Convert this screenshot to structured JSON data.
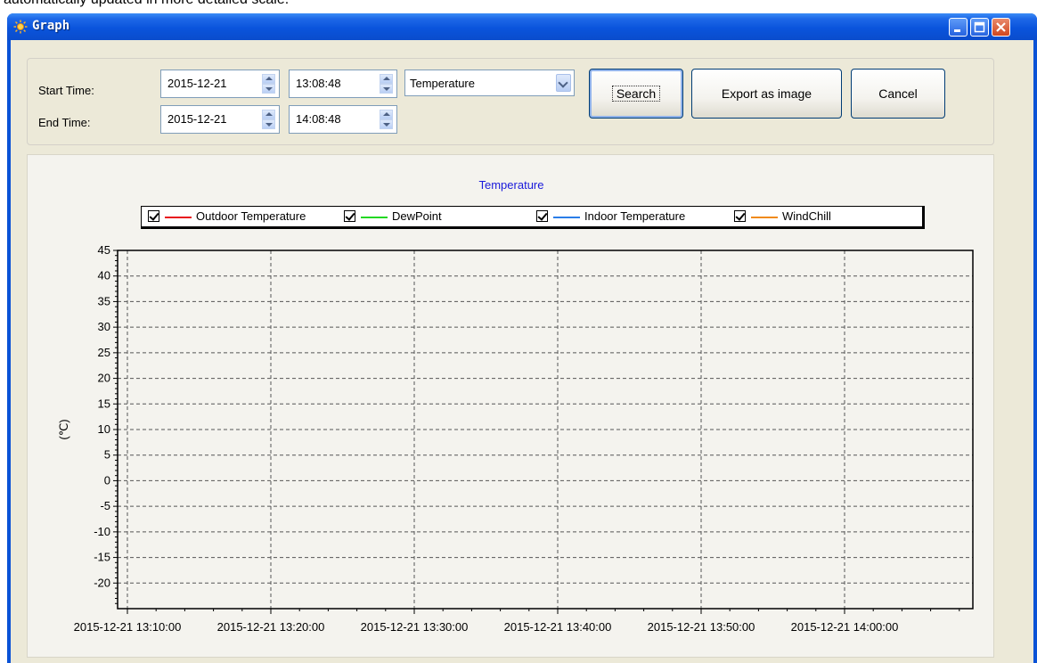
{
  "top_caption": "automatically updated in more detailed scale.",
  "window": {
    "title": "Graph"
  },
  "form": {
    "start_label": "Start Time:",
    "end_label": "End Time:",
    "start_date": "2015-12-21",
    "start_time": "13:08:48",
    "end_date": "2015-12-21",
    "end_time": "14:08:48",
    "type_selected": "Temperature",
    "search_label": "Search",
    "export_label": "Export as image",
    "cancel_label": "Cancel"
  },
  "colors": {
    "outdoor": "#e8141e",
    "dewpoint": "#22d822",
    "indoor": "#2a7ee8",
    "windchill": "#f08a18",
    "title": "#1a1adb"
  },
  "chart_data": {
    "type": "line",
    "title": "Temperature",
    "ylabel": "(℃)",
    "xlabel": "",
    "ylim": [
      -25,
      45
    ],
    "yticks": [
      45,
      40,
      35,
      30,
      25,
      20,
      15,
      10,
      5,
      0,
      -5,
      -10,
      -15,
      -20
    ],
    "xticks": [
      "2015-12-21 13:10:00",
      "2015-12-21 13:20:00",
      "2015-12-21 13:30:00",
      "2015-12-21 13:40:00",
      "2015-12-21 13:50:00",
      "2015-12-21 14:00:00"
    ],
    "grid": true,
    "legend_position": "top",
    "series": [
      {
        "name": "Outdoor Temperature",
        "values": []
      },
      {
        "name": "DewPoint",
        "values": []
      },
      {
        "name": "Indoor Temperature",
        "values": []
      },
      {
        "name": "WindChill",
        "values": []
      }
    ]
  }
}
